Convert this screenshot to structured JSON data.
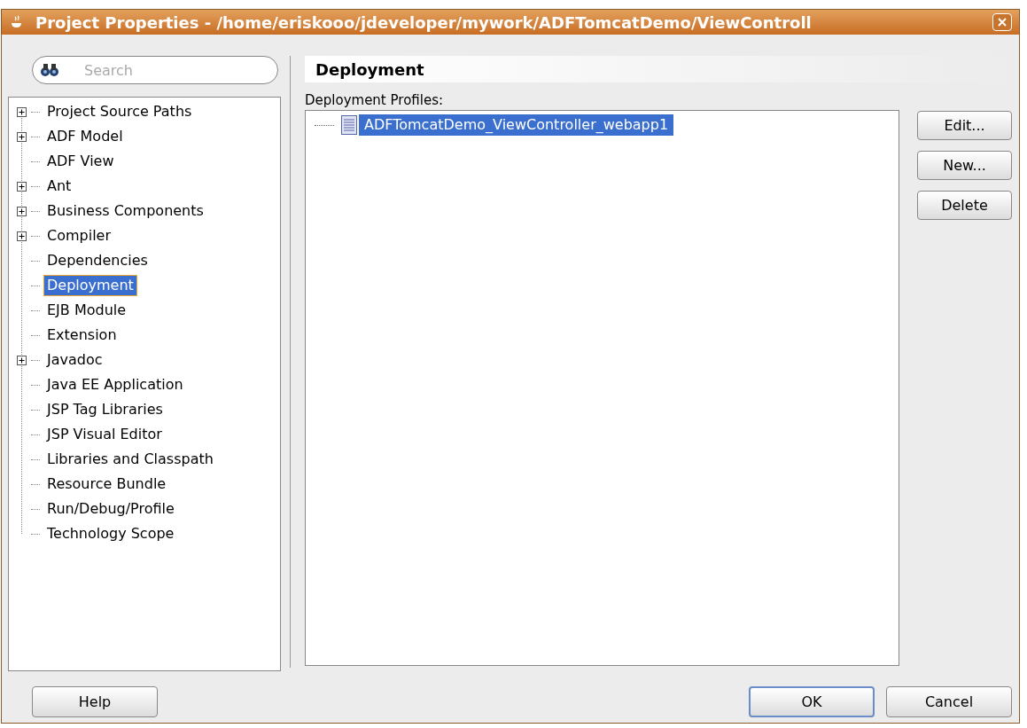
{
  "window": {
    "title": "Project Properties - /home/eriskooo/jdeveloper/mywork/ADFTomcatDemo/ViewControll"
  },
  "search": {
    "placeholder": "Search"
  },
  "tree": [
    {
      "label": "Project Source Paths",
      "kind": "folder",
      "selected": false
    },
    {
      "label": "ADF Model",
      "kind": "folder",
      "selected": false
    },
    {
      "label": "ADF View",
      "kind": "leaf",
      "selected": false
    },
    {
      "label": "Ant",
      "kind": "folder",
      "selected": false
    },
    {
      "label": "Business Components",
      "kind": "folder",
      "selected": false
    },
    {
      "label": "Compiler",
      "kind": "folder",
      "selected": false
    },
    {
      "label": "Dependencies",
      "kind": "leaf",
      "selected": false
    },
    {
      "label": "Deployment",
      "kind": "leaf",
      "selected": true
    },
    {
      "label": "EJB Module",
      "kind": "leaf",
      "selected": false
    },
    {
      "label": "Extension",
      "kind": "leaf",
      "selected": false
    },
    {
      "label": "Javadoc",
      "kind": "folder",
      "selected": false
    },
    {
      "label": "Java EE Application",
      "kind": "leaf",
      "selected": false
    },
    {
      "label": "JSP Tag Libraries",
      "kind": "leaf",
      "selected": false
    },
    {
      "label": "JSP Visual Editor",
      "kind": "leaf",
      "selected": false
    },
    {
      "label": "Libraries and Classpath",
      "kind": "leaf",
      "selected": false
    },
    {
      "label": "Resource Bundle",
      "kind": "leaf",
      "selected": false
    },
    {
      "label": "Run/Debug/Profile",
      "kind": "leaf",
      "selected": false
    },
    {
      "label": "Technology Scope",
      "kind": "leaf",
      "selected": false
    }
  ],
  "panel": {
    "heading": "Deployment",
    "profiles_label": "Deployment Profiles:",
    "profiles": [
      {
        "label": "ADFTomcatDemo_ViewController_webapp1",
        "selected": true
      }
    ],
    "buttons": [
      "Edit...",
      "New...",
      "Delete"
    ]
  },
  "footer": {
    "help": "Help",
    "buttons": [
      {
        "label": "OK",
        "default": true
      },
      {
        "label": "Cancel",
        "default": false
      }
    ]
  }
}
